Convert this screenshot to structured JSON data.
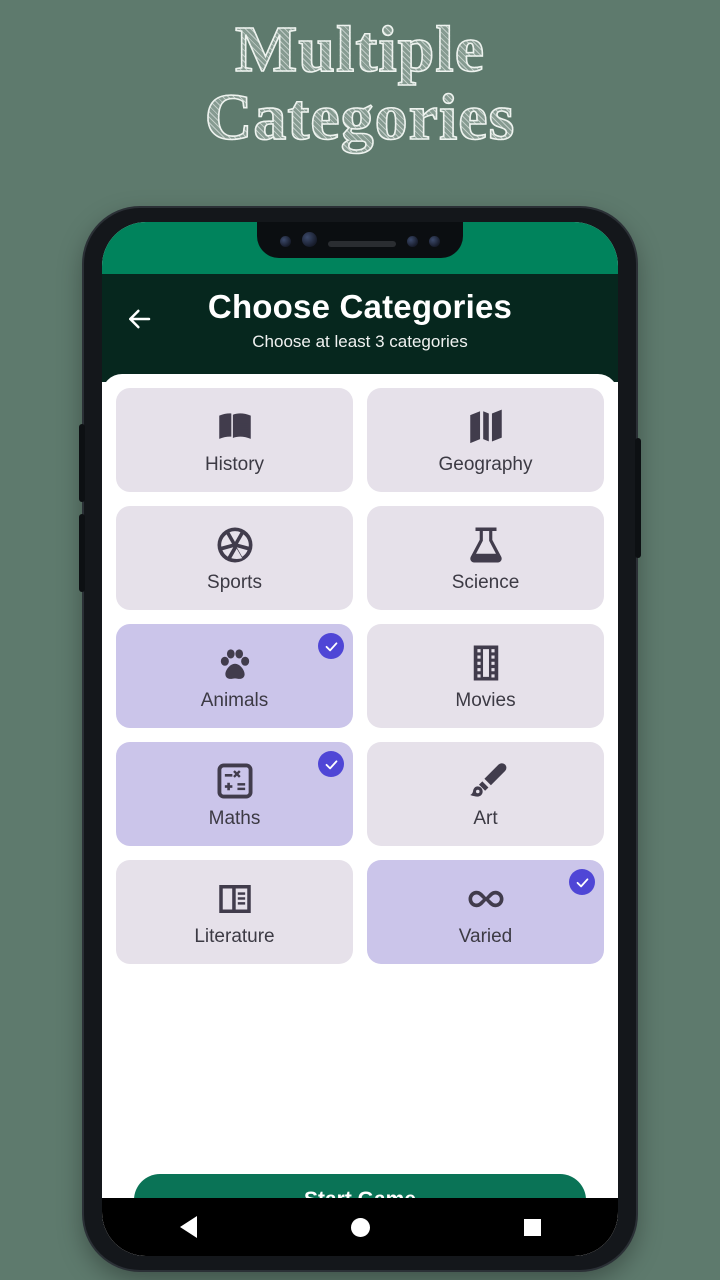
{
  "promo": {
    "line1": "Multiple",
    "line2": "Categories"
  },
  "appbar": {
    "back_icon": "arrow-left-icon",
    "title": "Choose Categories",
    "subtitle": "Choose at least 3 categories"
  },
  "categories": [
    {
      "label": "History",
      "icon": "open-book-icon",
      "selected": false
    },
    {
      "label": "Geography",
      "icon": "map-icon",
      "selected": false
    },
    {
      "label": "Sports",
      "icon": "sports-ball-icon",
      "selected": false
    },
    {
      "label": "Science",
      "icon": "flask-icon",
      "selected": false
    },
    {
      "label": "Animals",
      "icon": "paw-icon",
      "selected": true
    },
    {
      "label": "Movies",
      "icon": "film-strip-icon",
      "selected": false
    },
    {
      "label": "Maths",
      "icon": "calculator-icon",
      "selected": true
    },
    {
      "label": "Art",
      "icon": "paintbrush-icon",
      "selected": false
    },
    {
      "label": "Literature",
      "icon": "article-icon",
      "selected": false
    },
    {
      "label": "Varied",
      "icon": "infinity-icon",
      "selected": true
    }
  ],
  "footer": {
    "start_label": "Start Game"
  },
  "navbar": {
    "back": "back-triangle-icon",
    "home": "home-circle-icon",
    "recents": "recents-square-icon"
  },
  "colors": {
    "page_background": "#5e7a6d",
    "status_bar_green": "#00835c",
    "appbar_green": "#06271e",
    "card_unselected": "#e6e1ea",
    "card_selected": "#cbc5ea",
    "check_badge": "#4f46d6",
    "start_button": "#0a7356",
    "icon": "#413c4c"
  }
}
